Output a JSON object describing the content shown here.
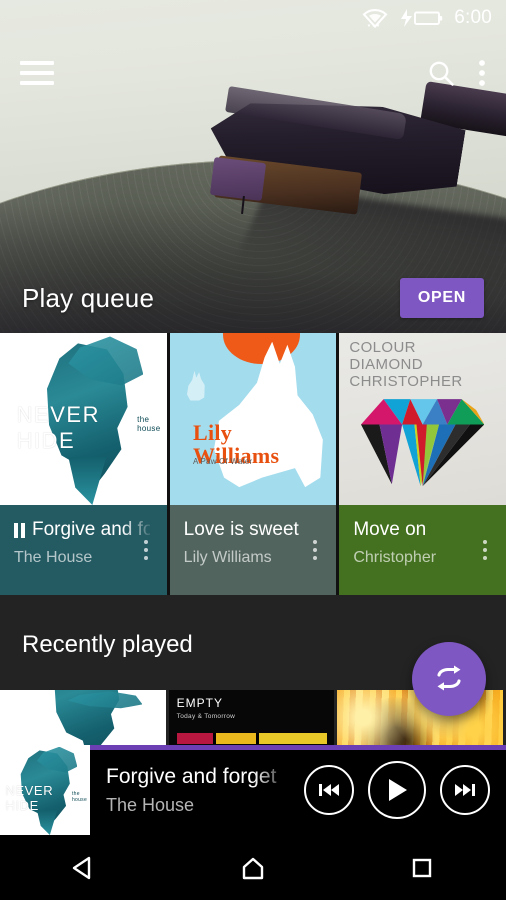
{
  "statusbar": {
    "time": "6:00",
    "icons": [
      "wifi-icon",
      "battery-charging-icon"
    ]
  },
  "appbar": {
    "menu_icon": "hamburger-menu-icon",
    "search_icon": "search-icon",
    "overflow_icon": "overflow-menu-icon"
  },
  "hero": {
    "title": "Play queue",
    "open_label": "OPEN",
    "accent_color": "#7e57c2"
  },
  "queue": {
    "tiles": [
      {
        "title": "Forgive and forget",
        "artist": "The House",
        "playing": true,
        "footer_color": "#245a62",
        "album": {
          "title": "NEVER HIDE",
          "subtitle": "the house"
        }
      },
      {
        "title": "Love is sweet",
        "artist": "Lily Williams",
        "playing": false,
        "footer_color": "#51645d",
        "album": {
          "title": "Lily\nWilliams",
          "subtitle": "A Paw Of Water"
        }
      },
      {
        "title": "Move on",
        "artist": "Christopher",
        "playing": false,
        "footer_color": "#44711f",
        "album": {
          "title": "COLOUR\nDIAMOND\nCHRISTOPHER",
          "subtitle": ""
        }
      }
    ]
  },
  "recent": {
    "title": "Recently played",
    "fab_icon": "repeat-icon",
    "fab_color": "#7e57c2",
    "items": [
      {
        "album_title": "NEVER HIDE",
        "album_subtitle": "the house"
      },
      {
        "album_title": "EMPTY",
        "album_subtitle": "Today & Tomorrow"
      },
      {
        "album_title": "",
        "album_subtitle": ""
      }
    ]
  },
  "player": {
    "title": "Forgive and forget",
    "artist": "The House",
    "progress_percent": 100,
    "prev_icon": "skip-previous-icon",
    "play_icon": "play-icon",
    "next_icon": "skip-next-icon"
  },
  "navbar": {
    "back_icon": "back-triangle-icon",
    "home_icon": "home-icon",
    "recents_icon": "recents-square-icon"
  }
}
